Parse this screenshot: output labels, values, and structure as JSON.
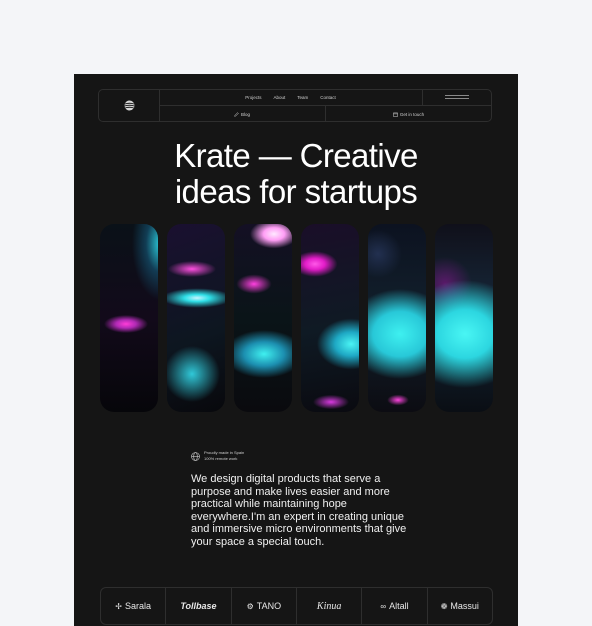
{
  "nav": {
    "links": [
      "Projects",
      "About",
      "Team",
      "Contact"
    ],
    "blog_label": "Blog",
    "touch_label": "Get in touch"
  },
  "hero": {
    "title_line1": "Krate — Creative",
    "title_line2": "ideas for startups"
  },
  "badge": {
    "line1": "Proudly made in Spain",
    "line2": "100% remote work"
  },
  "description": "We design digital products that serve a purpose and make lives easier and more practical while maintaining hope everywhere.I'm an expert in creating unique and immersive micro environments that give your space a special touch.",
  "brands": [
    "Sarala",
    "Tollbase",
    "TANO",
    "Kinua",
    "Altall",
    "Massui"
  ],
  "colors": {
    "background": "#f4f5f8",
    "panel": "#151515",
    "accent_cyan": "#2ee6e8",
    "accent_pink": "#f03ce0"
  }
}
